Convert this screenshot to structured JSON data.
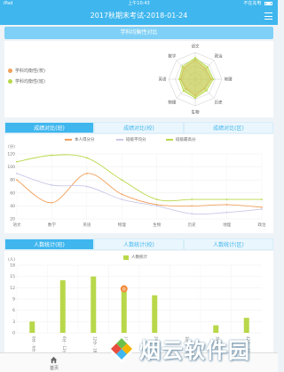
{
  "status_bar": {
    "device": "iPad",
    "time": "上午10:43",
    "battery": "不在充电"
  },
  "header": {
    "title": "2017秋期末考试-2018-01-24"
  },
  "radar_section": {
    "title": "学科均衡性对比",
    "legend": [
      {
        "label": "学科均衡性(校)",
        "color": "#f1a15c"
      },
      {
        "label": "学科均衡性(班)",
        "color": "#b8d84a"
      }
    ],
    "subjects": [
      "语文",
      "政治",
      "地理",
      "历史",
      "生物",
      "物理",
      "英语",
      "数学"
    ],
    "series": [
      {
        "name": "学科均衡性(校)",
        "color": "#f1a15c",
        "values": [
          0.72,
          0.55,
          0.6,
          0.5,
          0.62,
          0.5,
          0.55,
          0.6
        ]
      },
      {
        "name": "学科均衡性(班)",
        "color": "#b8d84a",
        "values": [
          0.8,
          0.65,
          0.68,
          0.6,
          0.7,
          0.62,
          0.6,
          0.68
        ]
      }
    ]
  },
  "score_tabs": [
    "成绩对比(班)",
    "成绩对比(校)",
    "成绩对比(区)"
  ],
  "score_chart": {
    "legend": [
      {
        "label": "本人得分分",
        "color": "#f1a15c"
      },
      {
        "label": "班级平均分",
        "color": "#c9c9e8"
      },
      {
        "label": "班级最高分",
        "color": "#b8d84a"
      }
    ],
    "unit_label": "(分)",
    "ylim": [
      20,
      120
    ],
    "yticks": [
      "120",
      "100",
      "80",
      "60",
      "40",
      "20"
    ],
    "categories": [
      "语文",
      "数学",
      "英语",
      "物理",
      "生物",
      "历史",
      "地理",
      "政治"
    ]
  },
  "chart_data": [
    {
      "type": "line",
      "title": "",
      "xlabel": "",
      "ylabel": "(分)",
      "categories": [
        "语文",
        "数学",
        "英语",
        "物理",
        "生物",
        "历史",
        "地理",
        "政治"
      ],
      "ylim": [
        20,
        120
      ],
      "series": [
        {
          "name": "本人得分分",
          "color": "#f1a15c",
          "values": [
            80,
            45,
            90,
            58,
            42,
            40,
            42,
            38
          ]
        },
        {
          "name": "班级平均分",
          "color": "#c9c9e8",
          "values": [
            90,
            72,
            70,
            50,
            40,
            28,
            30,
            35
          ]
        },
        {
          "name": "班级最高分",
          "color": "#b8d84a",
          "values": [
            108,
            118,
            114,
            80,
            50,
            50,
            50,
            50
          ]
        }
      ]
    },
    {
      "type": "bar",
      "title": "",
      "xlabel": "",
      "ylabel": "(人)",
      "categories": [
        "0分 - 6分",
        "6分 - 12分",
        "12分 - 18分",
        "18分 - 24分",
        "24分 - 30分",
        "30分 - 36分",
        "36分 - 42分",
        "42分 - 48分"
      ],
      "ylim": [
        0,
        18
      ],
      "series": [
        {
          "name": "人数统计",
          "color": "#b8d84a",
          "values": [
            3,
            14,
            15,
            11,
            10,
            0,
            2,
            4
          ]
        }
      ],
      "highlight": {
        "index": 3,
        "label": "自"
      }
    }
  ],
  "count_tabs": [
    "人数统计(班)",
    "人数统计(校)",
    "人数统计(区)"
  ],
  "count_chart": {
    "legend_label": "人数统计",
    "legend_color": "#b8d84a",
    "unit_label": "(人)",
    "yticks": [
      "18",
      "15",
      "12",
      "9",
      "6",
      "3",
      "0"
    ],
    "categories": [
      "0分 - 6分",
      "6分 - 12分",
      "12分 - 18分",
      "18分 - 24分",
      "24分 - 30分",
      "30分 - 36分",
      "36分 - 42分",
      "42分 - 48分"
    ],
    "highlight_label": "自"
  },
  "bottom_bar": {
    "home_label": "首页"
  },
  "watermark": {
    "text": "烟云软件园"
  }
}
